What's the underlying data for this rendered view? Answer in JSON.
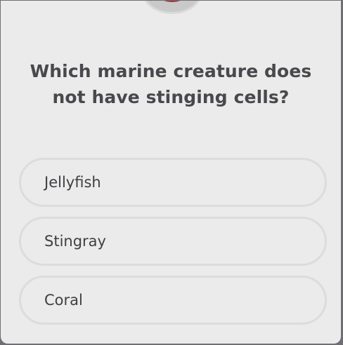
{
  "quiz": {
    "question": "Which marine creature does not have stinging cells?",
    "options": [
      {
        "label": "Jellyfish"
      },
      {
        "label": "Stingray"
      },
      {
        "label": "Coral"
      }
    ]
  },
  "colors": {
    "background": "#ebebeb",
    "question_text": "#48484d",
    "option_border": "#dcdcdc",
    "avatar_accent": "#8e2a35"
  },
  "icons": {
    "avatar": "profile-avatar"
  }
}
